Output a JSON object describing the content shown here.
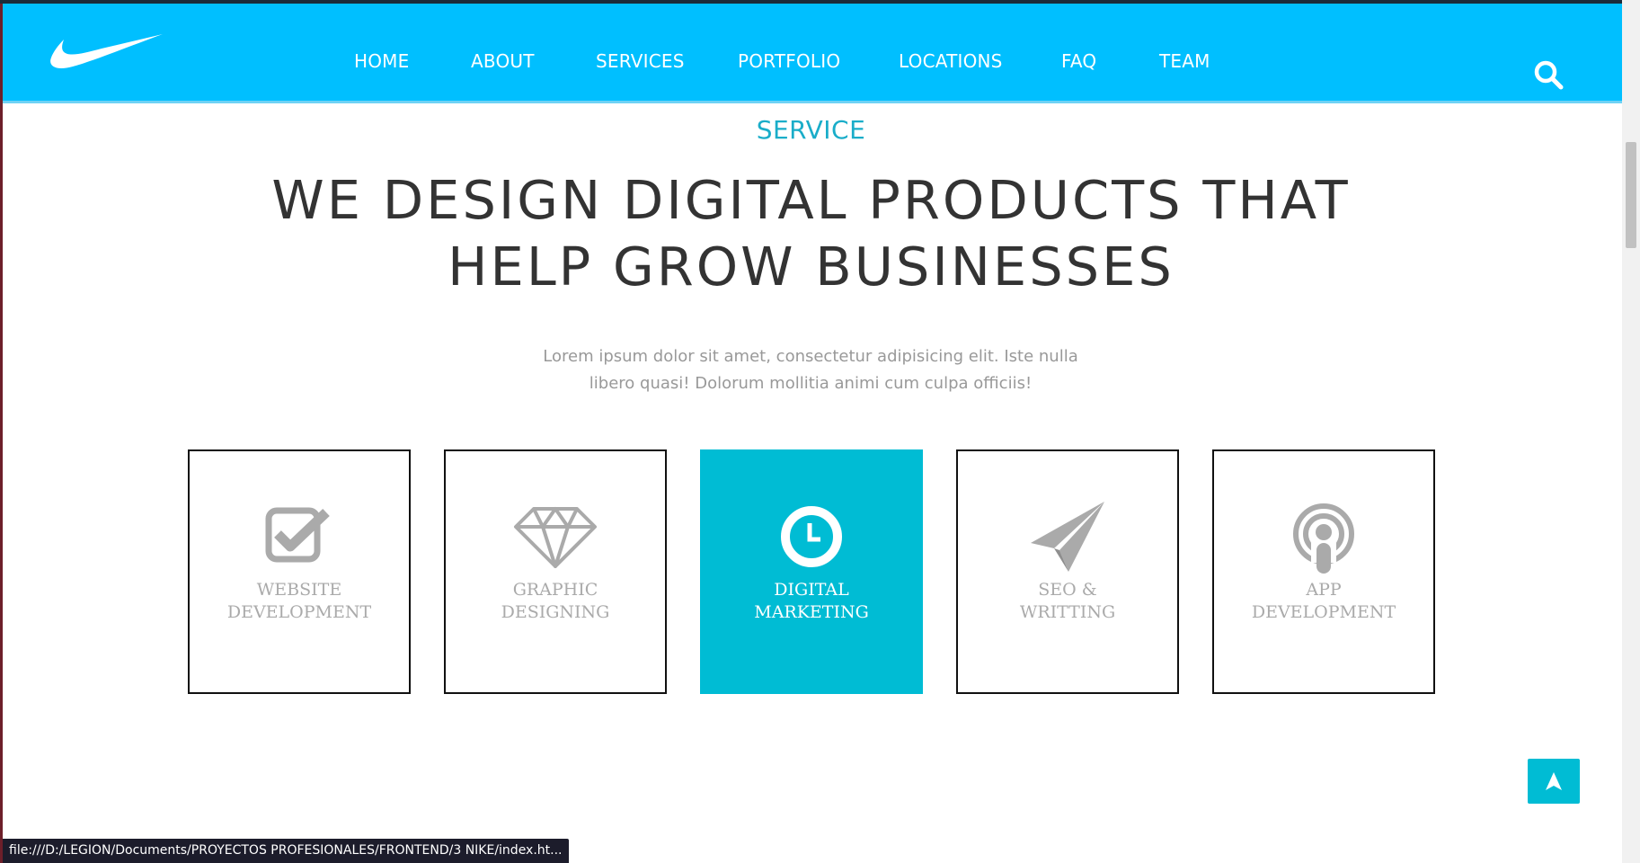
{
  "header": {
    "logo": "nike-swoosh-logo",
    "nav": [
      "HOME",
      "ABOUT",
      "SERVICES",
      "PORTFOLIO",
      "LOCATIONS",
      "FAQ",
      "TEAM"
    ],
    "search_icon": "search-icon"
  },
  "section": {
    "eyebrow": "SERVICE",
    "headline": [
      "WE DESIGN DIGITAL PRODUCTS THAT",
      "HELP GROW BUSINESSES"
    ],
    "intro": [
      "Lorem ipsum dolor sit amet, consectetur adipisicing elit. Iste nulla",
      "libero quasi! Dolorum mollitia animi cum culpa officiis!"
    ]
  },
  "services": [
    {
      "icon": "checkbox-check-icon",
      "label": [
        "WEBSITE",
        "DEVELOPMENT"
      ],
      "active": false
    },
    {
      "icon": "diamond-icon",
      "label": [
        "GRAPHIC",
        "DESIGNING"
      ],
      "active": false
    },
    {
      "icon": "clock-icon",
      "label": [
        "DIGITAL",
        "MARKETING"
      ],
      "active": true
    },
    {
      "icon": "paper-plane-icon",
      "label": [
        "SEO &",
        "WRITTING"
      ],
      "active": false
    },
    {
      "icon": "podcast-icon",
      "label": [
        "APP",
        "DEVELOPMENT"
      ],
      "active": false
    }
  ],
  "back_to_top": {
    "icon": "arrow-up-icon"
  },
  "status_bar": {
    "url": "file:///D:/LEGION/Documents/PROYECTOS PROFESIONALES/FRONTEND/3 NIKE/index.ht..."
  },
  "colors": {
    "navbar": "#00bfff",
    "accent": "#00bcd4",
    "eyebrow": "#1aadc9",
    "headline": "#333333",
    "muted": "#999999",
    "icon_gray": "#aaaaaa"
  }
}
